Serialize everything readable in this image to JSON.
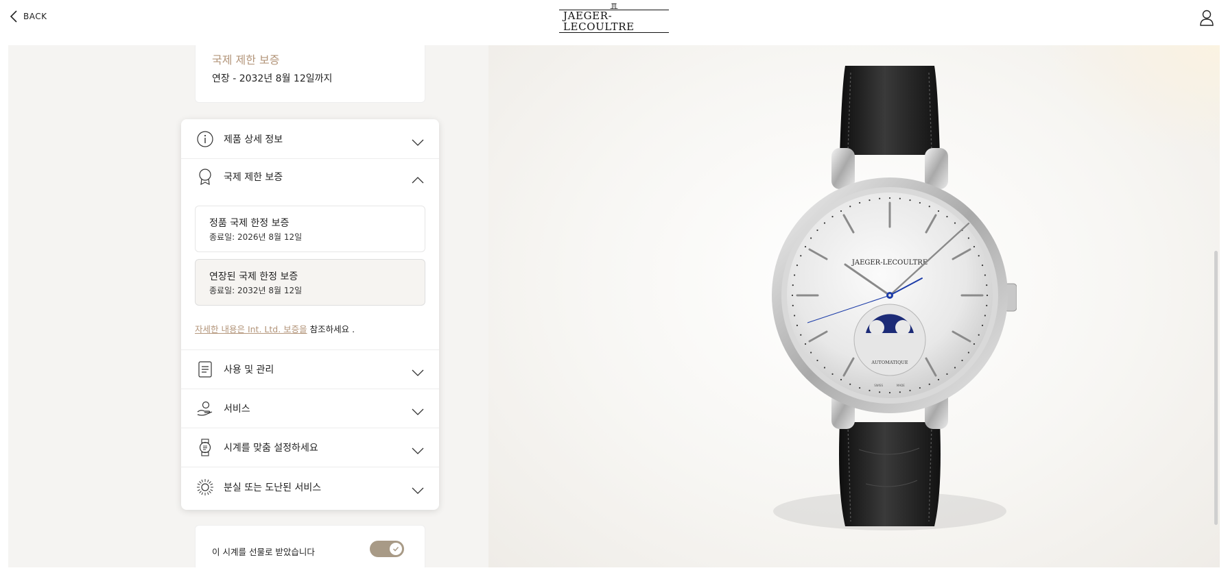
{
  "header": {
    "back_label": "BACK",
    "logo_text": "JAEGER-LECOULTRE",
    "icons": {
      "back": "chevron-left-icon",
      "user": "user-icon",
      "logo": "jlc-logo"
    }
  },
  "summary": {
    "title": "국제 제한 보증",
    "subtitle": "연장 - 2032년 8월 12일까지"
  },
  "accordion": {
    "items": [
      {
        "label": "제품 상세 정보",
        "icon": "info-icon",
        "expanded": false
      },
      {
        "label": "국제 제한 보증",
        "icon": "ribbon-icon",
        "expanded": true
      },
      {
        "label": "사용 및 관리",
        "icon": "document-icon",
        "expanded": false
      },
      {
        "label": "서비스",
        "icon": "hand-service-icon",
        "expanded": false
      },
      {
        "label": "시계를 맞춤 설정하세요",
        "icon": "watch-icon",
        "expanded": false
      },
      {
        "label": "분실 또는 도난된 서비스",
        "icon": "sunburst-icon",
        "expanded": false
      }
    ],
    "warranty": {
      "cards": [
        {
          "title": "정품 국제 한정 보증",
          "subtitle": "종료일: 2026년 8월 12일"
        },
        {
          "title": "연장된 국제 한정 보증",
          "subtitle": "종료일: 2032년 8월 12일"
        }
      ],
      "note_link": "자세한 내용은 Int. Ltd. 보증을",
      "note_rest": " 참조하세요 ."
    }
  },
  "gift": {
    "label": "이 시계를 선물로 받았습니다",
    "toggle_on": true
  },
  "watch": {
    "dial_brand": "JAEGER-LECOULTRE",
    "dial_text": "AUTOMATIQUE",
    "dial_footer_left": "SWISS",
    "dial_footer_right": "MADE"
  },
  "colors": {
    "accent": "#b3957a",
    "toggle": "#a89a86",
    "background": "#f5f4f2"
  }
}
